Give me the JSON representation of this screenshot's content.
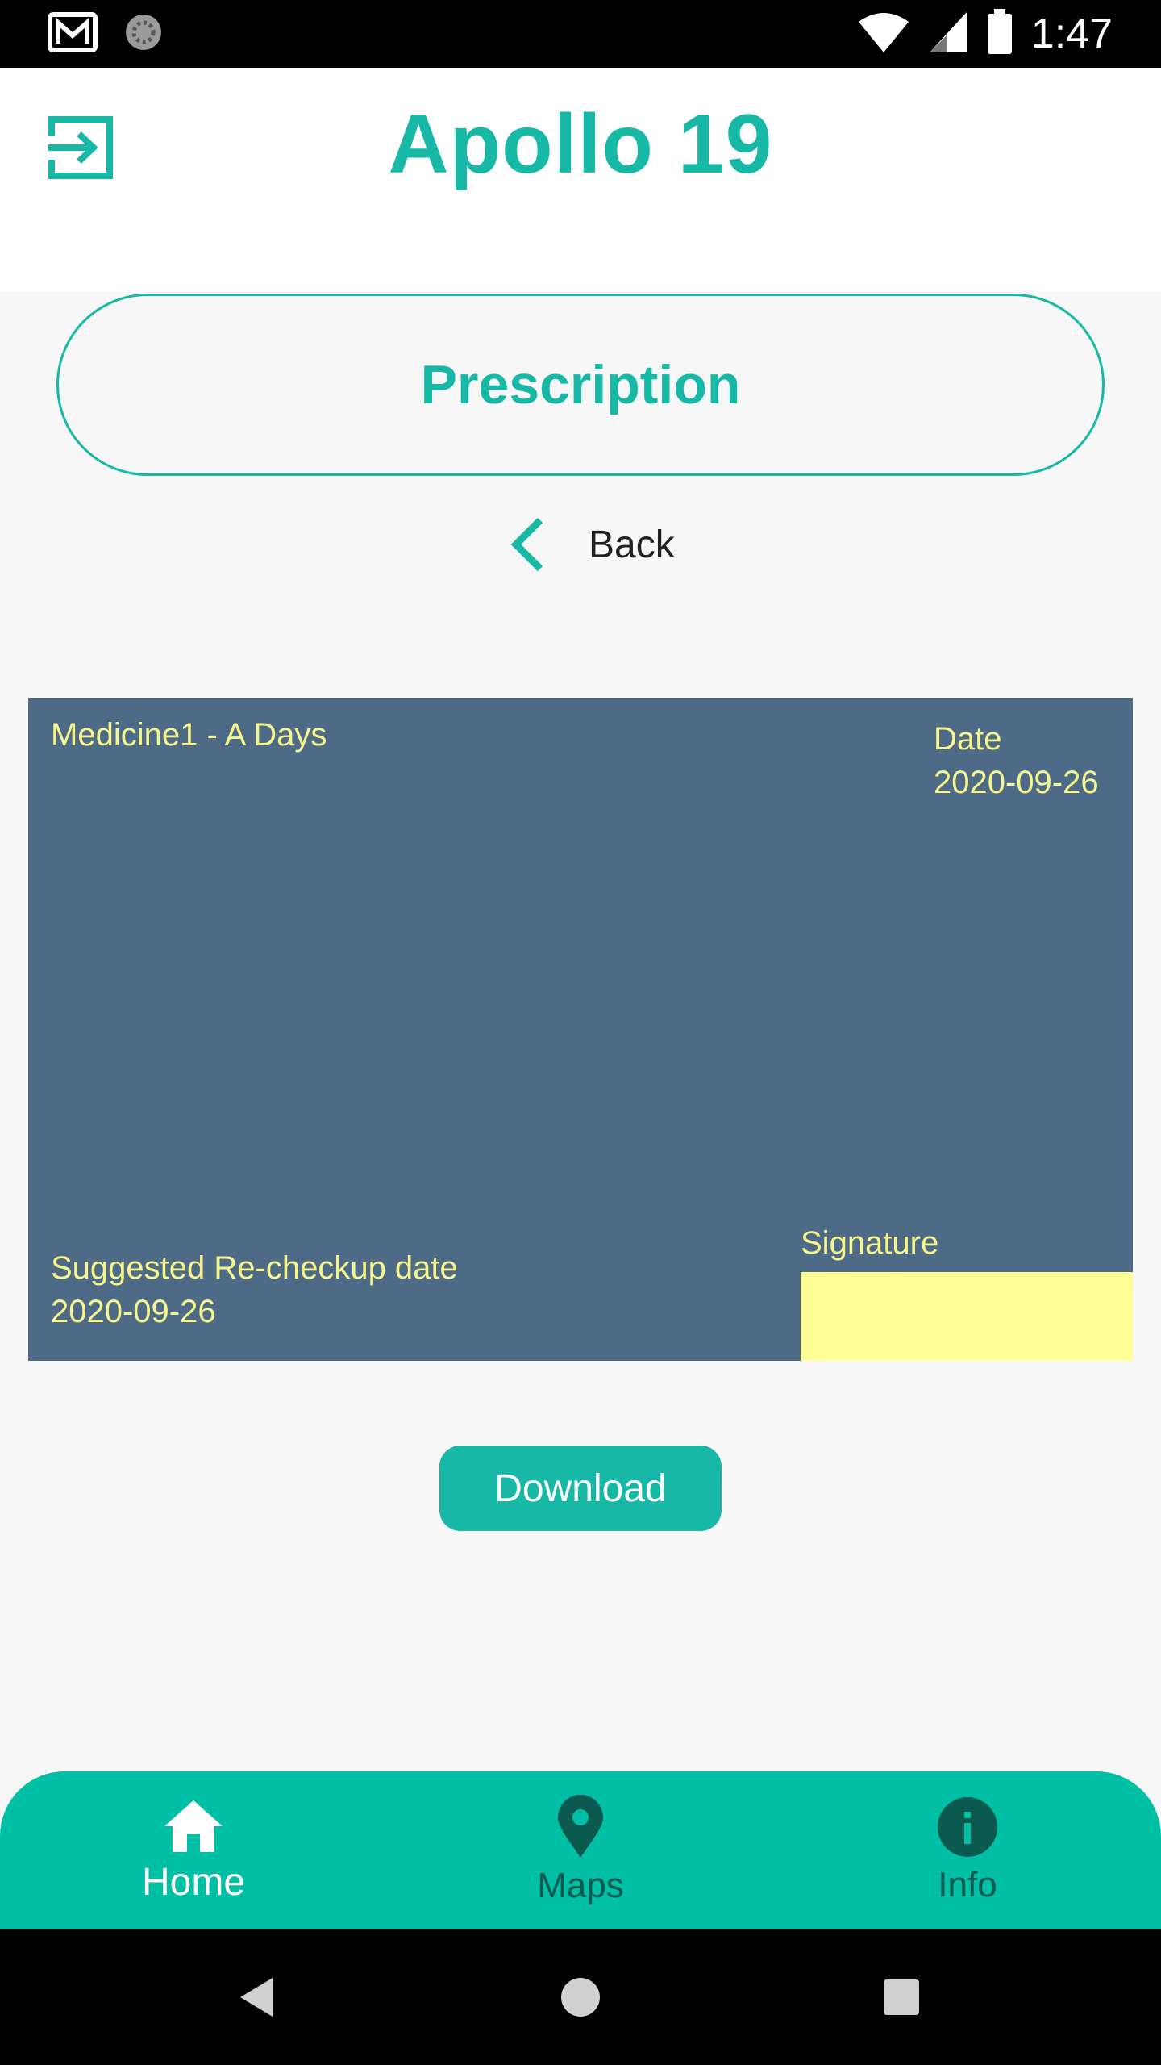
{
  "status_bar": {
    "time": "1:47",
    "icons": [
      "gmail-icon",
      "sync-icon",
      "wifi-icon",
      "signal-icon",
      "battery-icon"
    ]
  },
  "header": {
    "title": "Apollo 19",
    "left_icon": "logout-icon"
  },
  "section": {
    "title": "Prescription"
  },
  "back": {
    "label": "Back",
    "icon": "chevron-left-icon"
  },
  "prescription": {
    "medicine": "Medicine1 - A Days",
    "date_label": "Date",
    "date_value": "2020-09-26",
    "recheck_label": "Suggested Re-checkup date",
    "recheck_value": "2020-09-26",
    "signature_label": "Signature"
  },
  "download": {
    "label": "Download"
  },
  "bottom_nav": {
    "items": [
      {
        "label": "Home",
        "icon": "home-icon",
        "active": true
      },
      {
        "label": "Maps",
        "icon": "map-pin-icon",
        "active": false
      },
      {
        "label": "Info",
        "icon": "info-icon",
        "active": false
      }
    ]
  },
  "colors": {
    "accent": "#17b8a5",
    "nav_bg": "#00bfa5",
    "card_bg": "#4d6b87",
    "card_text": "#f6f68c",
    "signature_bg": "#fefe96"
  }
}
